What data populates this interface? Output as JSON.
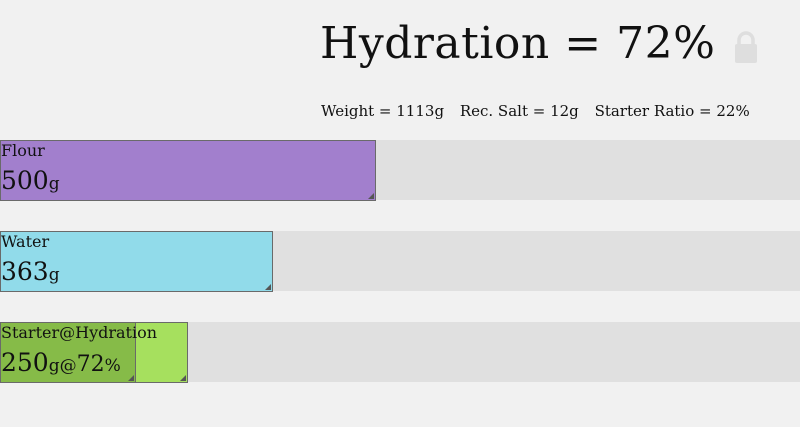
{
  "header": {
    "title": "Hydration = 72%",
    "lock_icon": "lock-icon"
  },
  "stats": {
    "weight": "Weight = 1113g",
    "rec_salt": "Rec. Salt = 12g",
    "starter_ratio": "Starter Ratio = 22%"
  },
  "ingredients": {
    "flour": {
      "label": "Flour",
      "amount": "500",
      "unit": "g",
      "fraction": 0.467,
      "color": "#a27fcd"
    },
    "water": {
      "label": "Water",
      "amount": "363",
      "unit": "g",
      "fraction": 0.339,
      "color": "#91dbea"
    },
    "starter": {
      "label": "Starter@Hydration",
      "amount": "250",
      "unit": "g",
      "sep": "@",
      "hydration": "72",
      "pct": "%",
      "fraction": 0.233,
      "hydration_fraction": 0.72,
      "color_light": "#a6e05e",
      "color_dark": "#86bb48"
    }
  }
}
